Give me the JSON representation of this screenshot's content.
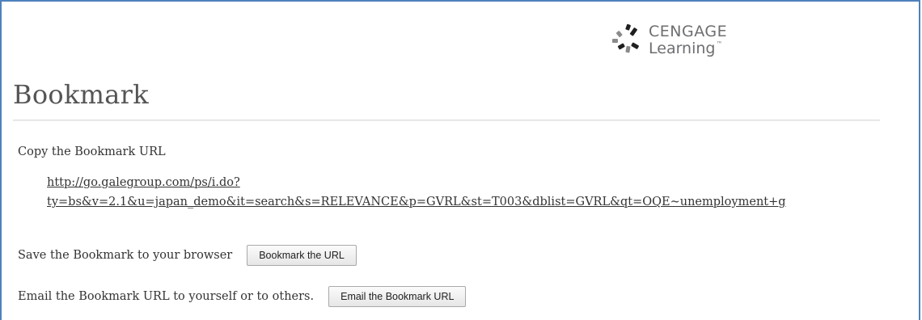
{
  "logo": {
    "name": "CENGAGE",
    "subname": "Learning",
    "tm": "™",
    "colors": [
      "#6d6e71",
      "#1f1f1f"
    ]
  },
  "page": {
    "title": "Bookmark"
  },
  "copy_section": {
    "label": "Copy the Bookmark URL",
    "url_line1": "http://go.galegroup.com/ps/i.do?",
    "url_line2": "ty=bs&v=2.1&u=japan_demo&it=search&s=RELEVANCE&p=GVRL&st=T003&dblist=GVRL&qt=OQE~unemployment+g"
  },
  "save_section": {
    "label": "Save the Bookmark to your browser",
    "button_label": "Bookmark the URL"
  },
  "email_section": {
    "label": "Email the Bookmark URL to yourself or to others.",
    "button_label": "Email the Bookmark URL"
  },
  "colors": {
    "frame_border": "#4f81bd",
    "title": "#555555",
    "text": "#333333"
  }
}
